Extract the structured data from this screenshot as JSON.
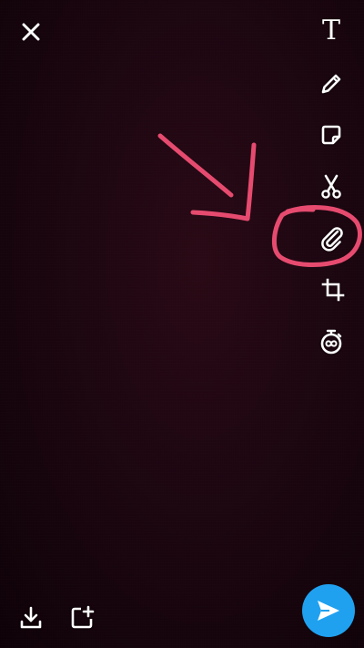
{
  "top_bar": {
    "close_icon": "close-icon"
  },
  "tool_rail": {
    "items": [
      {
        "name": "text-tool",
        "icon": "text-icon",
        "glyph": "T"
      },
      {
        "name": "draw-tool",
        "icon": "pencil-icon"
      },
      {
        "name": "sticker-tool",
        "icon": "sticker-icon"
      },
      {
        "name": "scissors-tool",
        "icon": "scissors-icon"
      },
      {
        "name": "attachment-tool",
        "icon": "paperclip-icon"
      },
      {
        "name": "crop-tool",
        "icon": "crop-icon"
      },
      {
        "name": "timer-tool",
        "icon": "timer-icon"
      }
    ]
  },
  "bottom_bar": {
    "save_icon": "download-icon",
    "add_story_icon": "add-to-story-icon",
    "send_icon": "send-arrow-icon"
  },
  "annotation": {
    "color": "#e64b6f",
    "shapes": [
      "arrow",
      "circle"
    ]
  },
  "colors": {
    "background": "#1d0711",
    "icon": "#ffffff",
    "send_button": "#1fa1f0"
  }
}
